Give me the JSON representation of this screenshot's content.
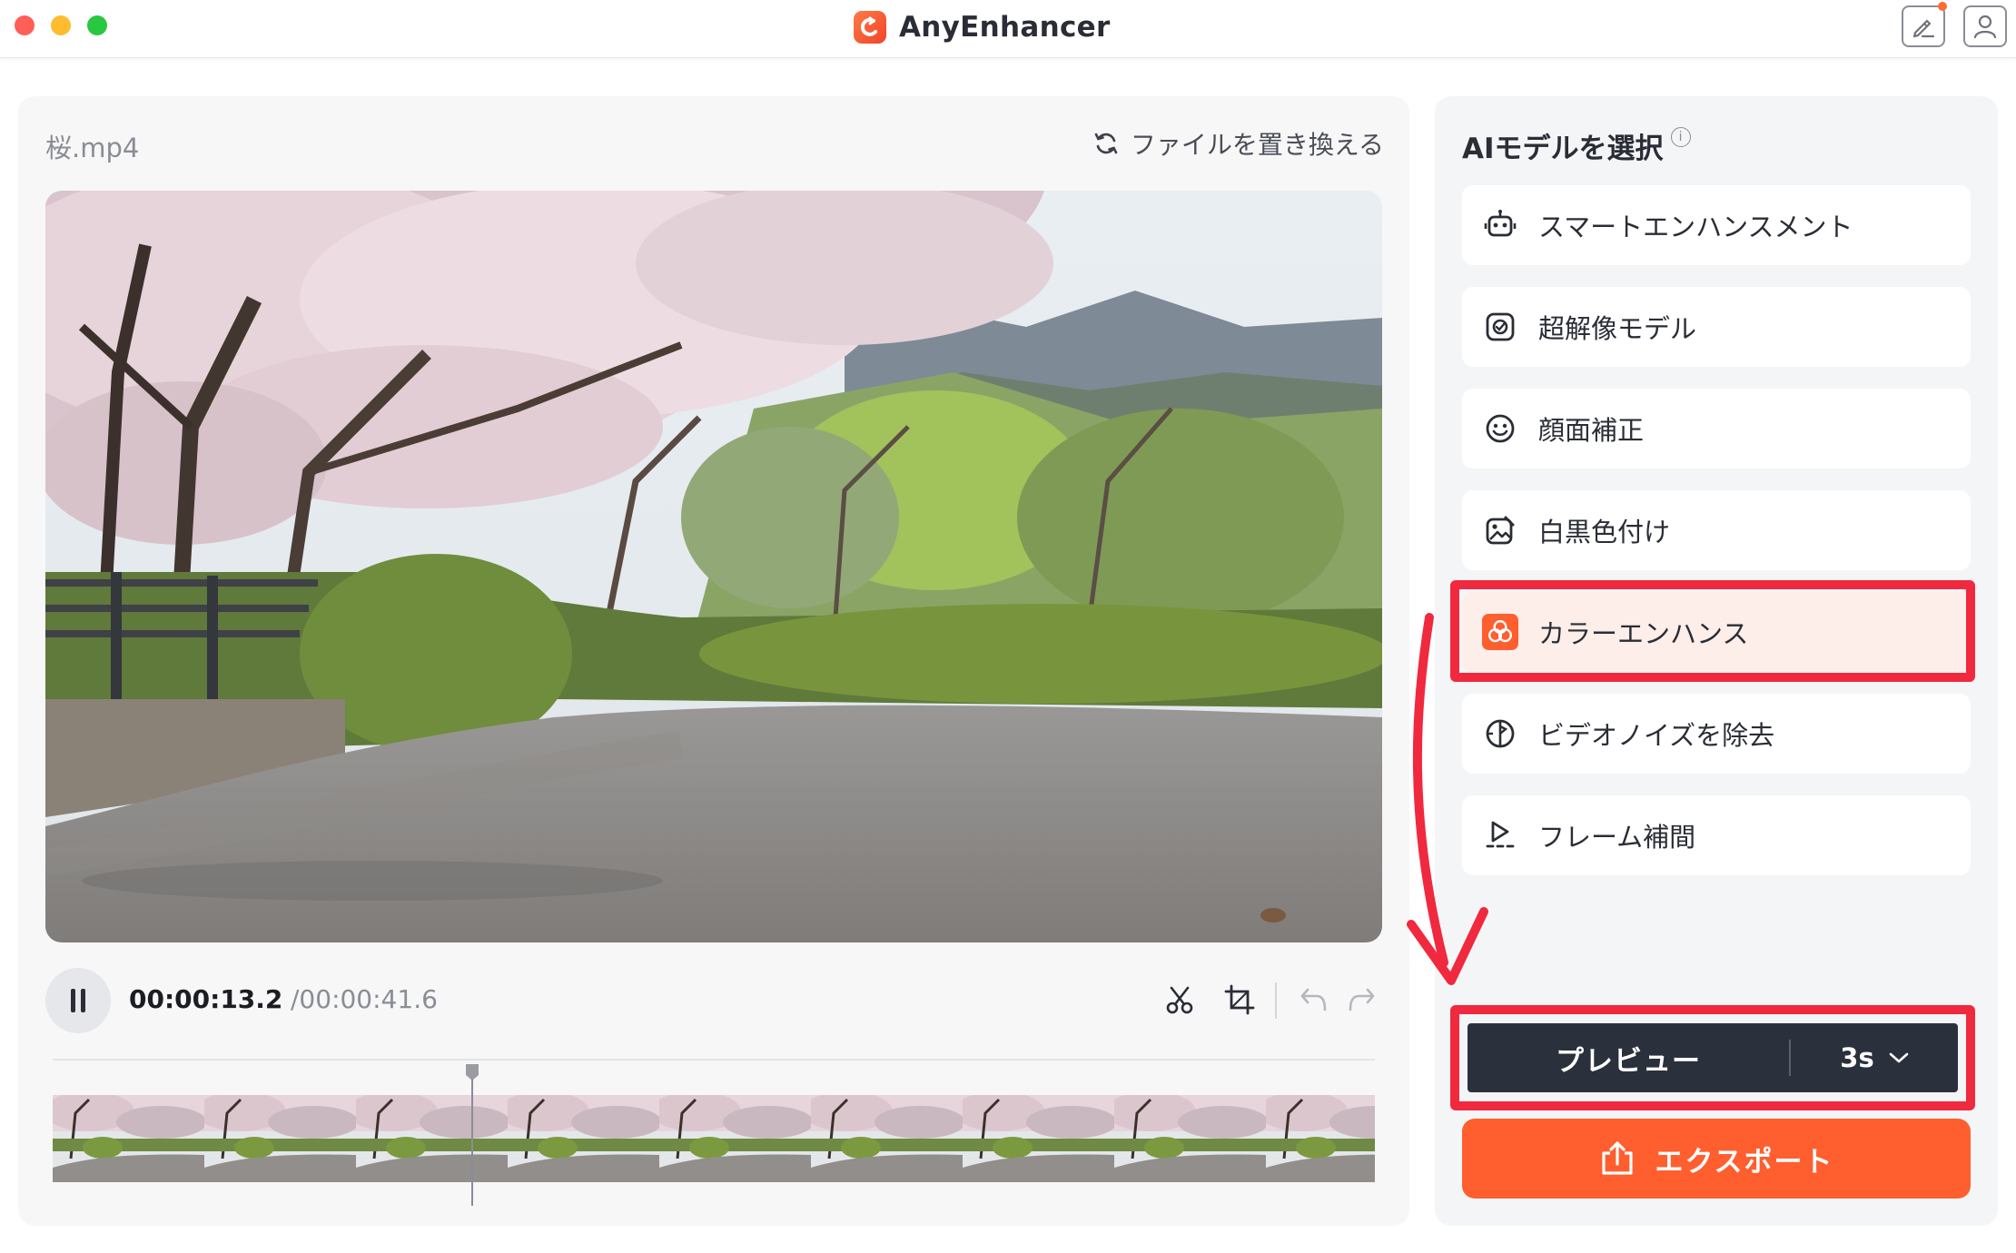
{
  "window": {
    "title": "AnyEnhancer"
  },
  "editor": {
    "file_name": "桜.mp4",
    "replace_file_label": "ファイルを置き換える",
    "current_time": "00:00:13.2",
    "total_time": "/00:00:41.6",
    "timeline_frame_count": 9,
    "playhead_progress": 0.317
  },
  "model_panel": {
    "title": "AIモデルを選択",
    "info_glyph": "i",
    "models": [
      {
        "label": "スマートエンハンスメント",
        "icon": "robot-icon",
        "selected": false
      },
      {
        "label": "超解像モデル",
        "icon": "super-resolution-icon",
        "selected": false
      },
      {
        "label": "顔面補正",
        "icon": "face-smile-icon",
        "selected": false
      },
      {
        "label": "白黒色付け",
        "icon": "colorize-image-icon",
        "selected": false
      },
      {
        "label": "カラーエンハンス",
        "icon": "color-circles-icon",
        "selected": true
      },
      {
        "label": "ビデオノイズを除去",
        "icon": "denoise-icon",
        "selected": false
      },
      {
        "label": "フレーム補間",
        "icon": "frame-interpolation-icon",
        "selected": false
      }
    ]
  },
  "actions": {
    "preview_label": "プレビュー",
    "preview_duration": "3s",
    "export_label": "エクスポート"
  },
  "colors": {
    "accent": "#ff5e2f",
    "annotation_red": "#f0293e",
    "preview_bg": "#2b303d",
    "selected_bg": "#fdeee9"
  }
}
